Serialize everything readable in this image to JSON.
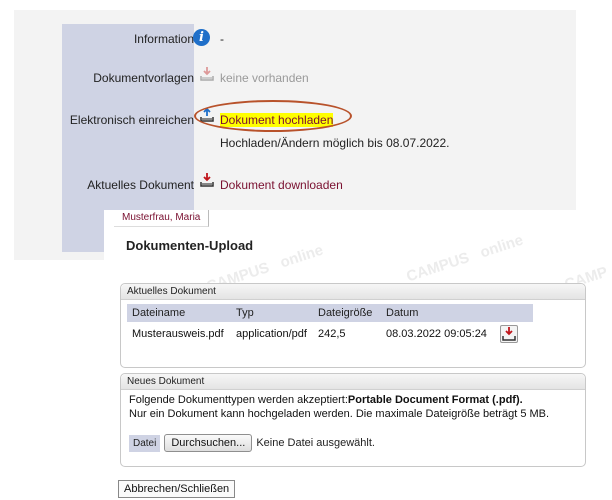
{
  "info_panel": {
    "information_label": "Information",
    "information_value": "-",
    "templates_label": "Dokumentvorlagen",
    "templates_value": "keine vorhanden",
    "submit_label": "Elektronisch einreichen",
    "upload_link": "Dokument hochladen",
    "upload_deadline": "Hochladen/Ändern möglich bis 08.07.2022.",
    "current_label": "Aktuelles Dokument",
    "download_link": "Dokument downloaden"
  },
  "dialog": {
    "user_tab": "Musterfrau, Maria",
    "title": "Dokumenten-Upload",
    "current_section": {
      "heading": "Aktuelles Dokument",
      "columns": [
        "Dateiname",
        "Typ",
        "Dateigröße",
        "Datum"
      ],
      "rows": [
        {
          "filename": "Musterausweis.pdf",
          "type": "application/pdf",
          "size": "242,5",
          "date": "08.03.2022 09:05:24"
        }
      ]
    },
    "new_section": {
      "heading": "Neues Dokument",
      "accepted_prefix": "Folgende Dokumenttypen werden akzeptiert:",
      "accepted_types": "Portable Document Format (.pdf).",
      "limit_text": "Nur ein Dokument kann hochgeladen werden. Die maximale Dateigröße beträgt 5 MB.",
      "file_label": "Datei",
      "browse_button": "Durchsuchen...",
      "no_file_text": "Keine Datei ausgewählt."
    },
    "close_button": "Abbrechen/Schließen"
  },
  "colors": {
    "label_column": "#cfd3e4",
    "link": "#7a1030",
    "highlight": "#ffff00",
    "annotation_ellipse": "#b8522b"
  },
  "icons": {
    "information": "info-circle-icon",
    "templates": "tray-download-icon",
    "upload": "tray-upload-icon",
    "download": "tray-download-icon"
  }
}
